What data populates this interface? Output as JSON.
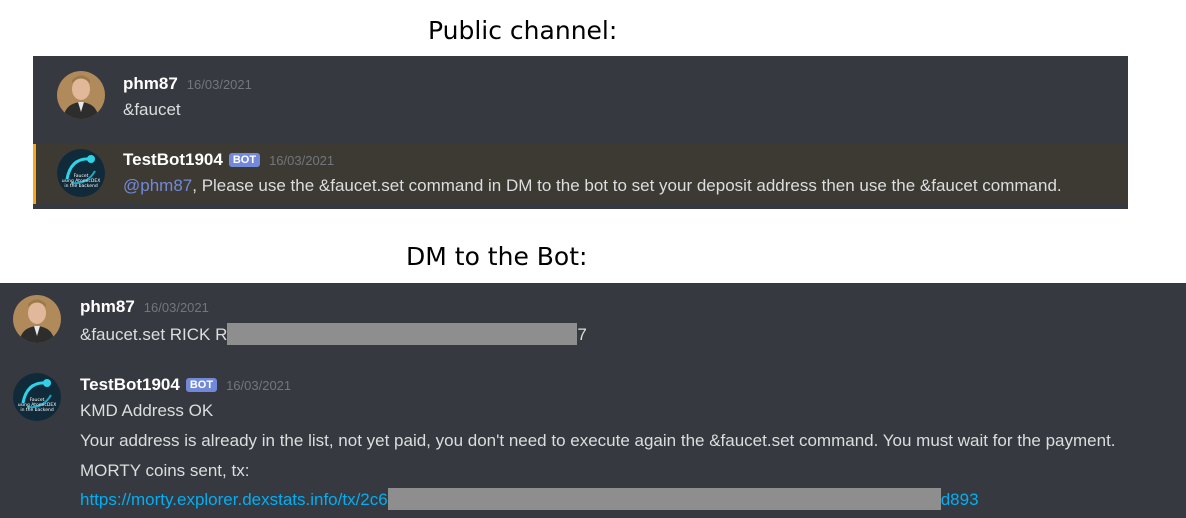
{
  "public_heading": "Public channel:",
  "dm_heading": "DM to the Bot:",
  "public": {
    "user_msg": {
      "username": "phm87",
      "timestamp": "16/03/2021",
      "text": "&faucet"
    },
    "bot_msg": {
      "username": "TestBot1904",
      "badge": "BOT",
      "timestamp": "16/03/2021",
      "mention": "@phm87",
      "text": ", Please use the &faucet.set command in DM to the bot to set your deposit address then use the &faucet command.",
      "avatar_text": [
        "Faucet",
        "using AtomicDEX",
        "in the backend"
      ]
    }
  },
  "dm": {
    "user_msg": {
      "username": "phm87",
      "timestamp": "16/03/2021",
      "text_prefix": "&faucet.set RICK R",
      "text_suffix": "7"
    },
    "bot_msg": {
      "username": "TestBot1904",
      "badge": "BOT",
      "timestamp": "16/03/2021",
      "line1": "KMD Address OK",
      "line2": "Your address is already in the list, not yet paid, you don't need to execute again the &faucet.set command. You must wait for the payment.",
      "line3": "MORTY coins sent, tx:",
      "link_prefix": "https://morty.explorer.dexstats.info/tx/2c6",
      "link_suffix": "d893",
      "avatar_text": [
        "Faucet",
        "using AtomicDEX",
        "in the backend"
      ]
    }
  },
  "colors": {
    "panel_bg": "#36393f",
    "mention_bg": "#3c3a33",
    "mention_bar": "#faa61a",
    "bot_badge": "#7289da",
    "link": "#00aff4",
    "mention_text": "#7289da"
  }
}
